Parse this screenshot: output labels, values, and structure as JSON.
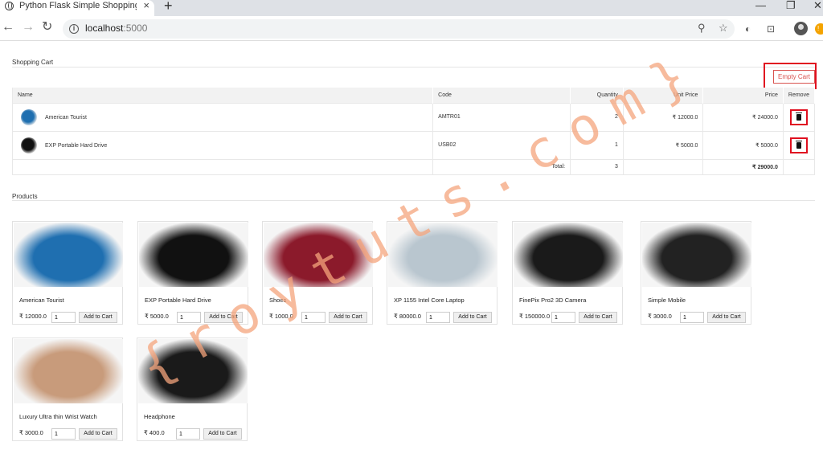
{
  "browser": {
    "tab_title": "Python Flask Simple Shopping C",
    "tab_close": "×",
    "new_tab": "+",
    "url_host": "localhost",
    "url_port": ":5000",
    "info_glyph": "i"
  },
  "cart": {
    "section_title": "Shopping Cart",
    "empty_button": "Empty Cart",
    "headers": {
      "name": "Name",
      "code": "Code",
      "quantity": "Quantity",
      "unit_price": "Unit Price",
      "price": "Price",
      "remove": "Remove"
    },
    "rows": [
      {
        "name": "American Tourist",
        "code": "AMTR01",
        "quantity": "2",
        "unit_price": "₹ 12000.0",
        "price": "₹ 24000.0",
        "color": "#1f6fb0"
      },
      {
        "name": "EXP Portable Hard Drive",
        "code": "USB02",
        "quantity": "1",
        "unit_price": "₹ 5000.0",
        "price": "₹ 5000.0",
        "color": "#111111"
      }
    ],
    "total_label": "Total:",
    "total_quantity": "3",
    "total_price": "₹ 29000.0"
  },
  "products": {
    "section_title": "Products",
    "add_label": "Add to Cart",
    "items": [
      {
        "name": "American Tourist",
        "price": "₹ 12000.0",
        "qty": "1",
        "color": "#1f6fb0"
      },
      {
        "name": "EXP Portable Hard Drive",
        "price": "₹ 5000.0",
        "qty": "1",
        "color": "#111111"
      },
      {
        "name": "Shoes",
        "price": "₹ 1000.0",
        "qty": "1",
        "color": "#8b1a2b"
      },
      {
        "name": "XP 1155 Intel Core Laptop",
        "price": "₹ 80000.0",
        "qty": "1",
        "color": "#b9c6cf"
      },
      {
        "name": "FinePix Pro2 3D Camera",
        "price": "₹ 150000.0",
        "qty": "1",
        "color": "#1a1a1a"
      },
      {
        "name": "Simple Mobile",
        "price": "₹ 3000.0",
        "qty": "1",
        "color": "#222222"
      },
      {
        "name": "Luxury Ultra thin Wrist Watch",
        "price": "₹ 3000.0",
        "qty": "1",
        "color": "#c89b7b"
      },
      {
        "name": "Headphone",
        "price": "₹ 400.0",
        "qty": "1",
        "color": "#1a1a1a"
      }
    ]
  },
  "watermark": "{roytuts.com}",
  "colors": {
    "accent_red": "#e01020",
    "danger": "#d9534f",
    "watermark": "#f4a47c"
  }
}
